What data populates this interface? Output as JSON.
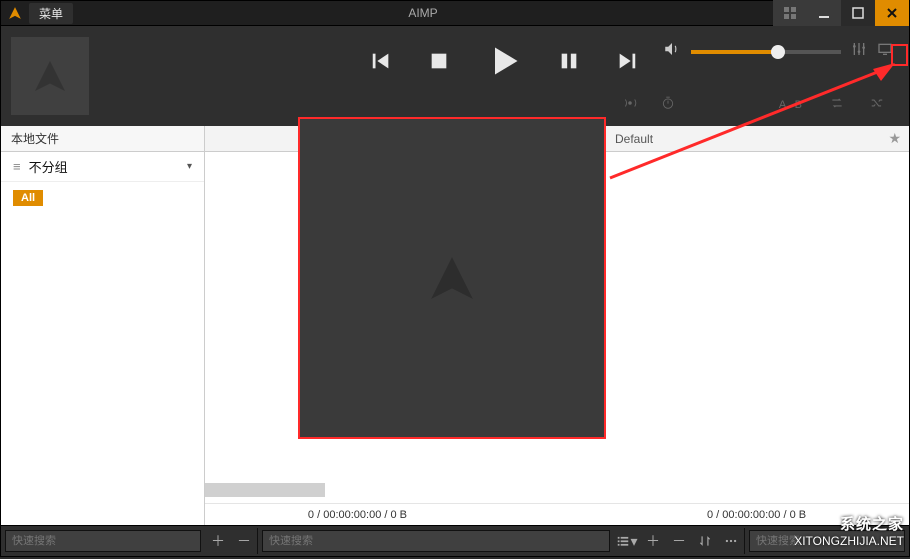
{
  "titlebar": {
    "menu_label": "菜单",
    "app_title": "AIMP"
  },
  "player": {
    "volume_percent": 58,
    "ab_label": "A B"
  },
  "left_panel": {
    "tab_label": "本地文件",
    "group_label": "不分组",
    "all_chip": "All"
  },
  "right_panel": {
    "tab_label": "Default",
    "status_left": "0 / 00:00:00:00 / 0 B",
    "status_right": "0 / 00:00:00:00 / 0 B"
  },
  "footer": {
    "search_placeholder": "快速搜索"
  },
  "watermark": {
    "line1": "系统之家",
    "line2": "XITONGZHIJIA.NET"
  }
}
